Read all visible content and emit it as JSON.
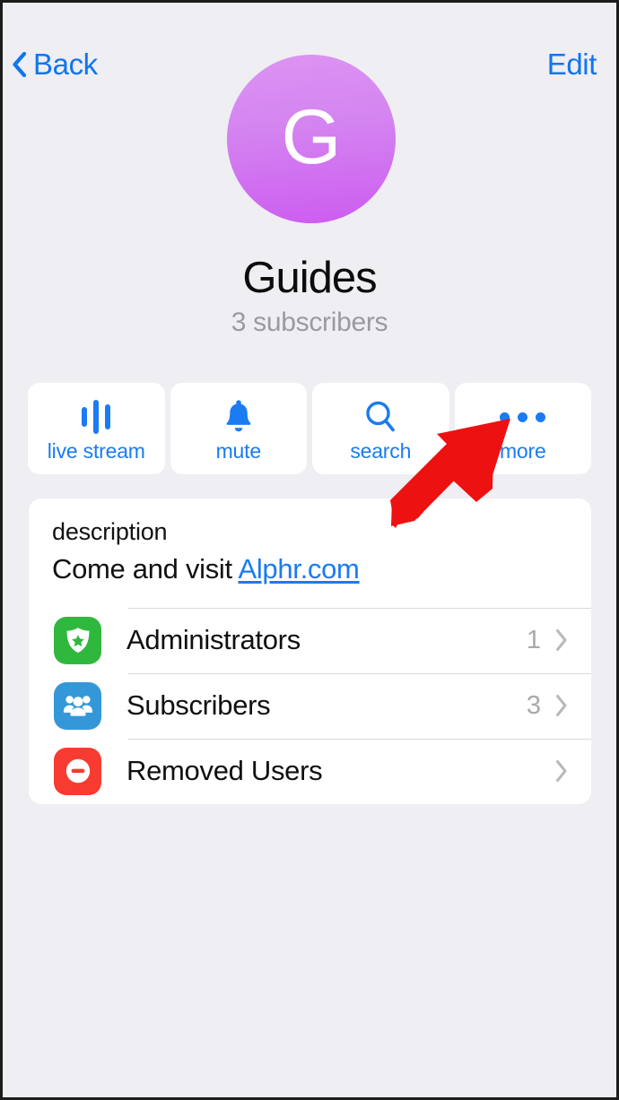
{
  "theme": {
    "background": "#eeeef3",
    "card_background": "#ffffff",
    "accent_blue": "#1a7bf2",
    "nav_blue": "#1175f0",
    "avatar_gradient_from": "#dd93f3",
    "avatar_gradient_to": "#cc5cf0",
    "annotation_red": "#ee1111",
    "muted_gray": "#9a9a9f"
  },
  "navbar": {
    "back_label": "Back",
    "back_icon": "chevron-left-icon",
    "edit_label": "Edit"
  },
  "profile": {
    "avatar_letter": "G",
    "title": "Guides",
    "subtitle": "3 subscribers"
  },
  "actions": [
    {
      "id": "live-stream",
      "label": "live stream",
      "icon": "live-stream-icon"
    },
    {
      "id": "mute",
      "label": "mute",
      "icon": "bell-icon"
    },
    {
      "id": "search",
      "label": "search",
      "icon": "search-icon"
    },
    {
      "id": "more",
      "label": "more",
      "icon": "ellipsis-icon"
    }
  ],
  "description": {
    "label": "description",
    "text_prefix": "Come and visit ",
    "link_text": "Alphr.com"
  },
  "rows": [
    {
      "id": "administrators",
      "label": "Administrators",
      "count": "1",
      "icon": "police-badge-icon",
      "icon_color": "green",
      "chevron": "chevron-right-icon"
    },
    {
      "id": "subscribers",
      "label": "Subscribers",
      "count": "3",
      "icon": "group-people-icon",
      "icon_color": "blue",
      "chevron": "chevron-right-icon"
    },
    {
      "id": "removed-users",
      "label": "Removed Users",
      "count": "",
      "icon": "block-minus-icon",
      "icon_color": "red",
      "chevron": "chevron-right-icon"
    }
  ],
  "annotation": {
    "type": "arrow",
    "points_at": "more",
    "color": "#ee1111"
  }
}
